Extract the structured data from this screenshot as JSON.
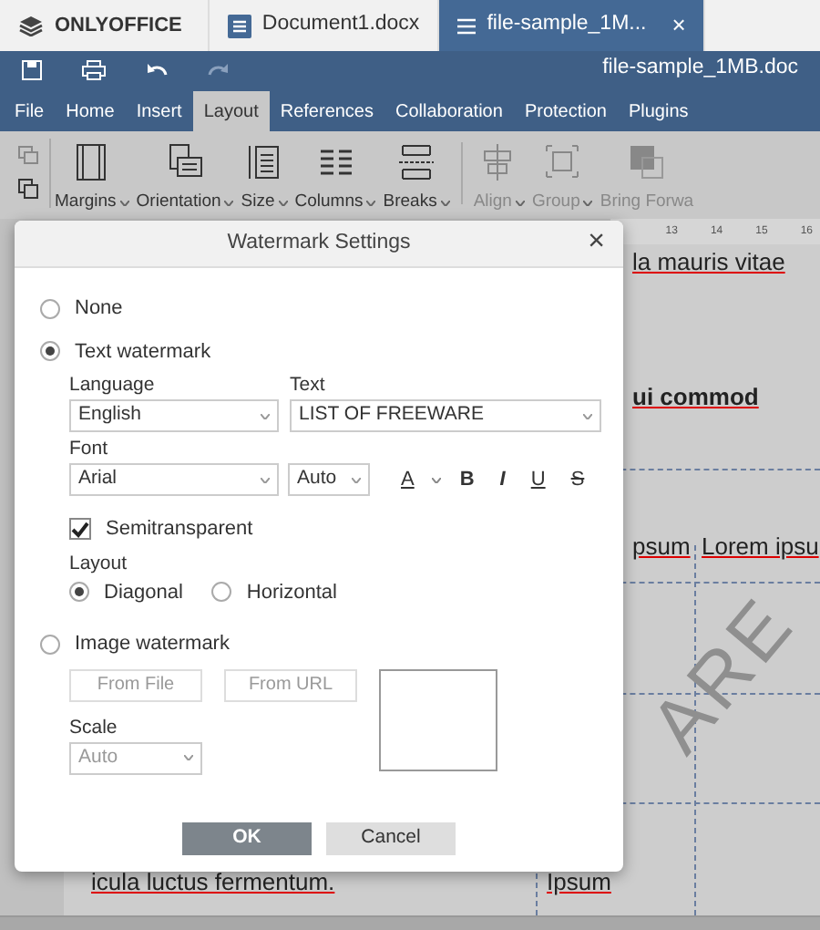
{
  "app_tabs": [
    {
      "label": "ONLYOFFICE",
      "kind": "logo",
      "selected": false
    },
    {
      "label": "Document1.docx",
      "kind": "doc",
      "selected": false
    },
    {
      "label": "file-sample_1M...",
      "kind": "doc",
      "selected": true,
      "close": "×"
    }
  ],
  "document_title": "file-sample_1MB.doc",
  "menu_tabs": [
    {
      "label": "File",
      "selected": false
    },
    {
      "label": "Home",
      "selected": false
    },
    {
      "label": "Insert",
      "selected": false
    },
    {
      "label": "Layout",
      "selected": true
    },
    {
      "label": "References",
      "selected": false
    },
    {
      "label": "Collaboration",
      "selected": false
    },
    {
      "label": "Protection",
      "selected": false
    },
    {
      "label": "Plugins",
      "selected": false
    }
  ],
  "ribbon": [
    {
      "label": "Margins",
      "kind": "margins",
      "disabled": false
    },
    {
      "label": "Orientation",
      "kind": "orientation",
      "disabled": false
    },
    {
      "label": "Size",
      "kind": "size",
      "disabled": false
    },
    {
      "label": "Columns",
      "kind": "columns",
      "disabled": false
    },
    {
      "label": "Breaks",
      "kind": "breaks",
      "disabled": false
    },
    {
      "label": "Align",
      "kind": "align",
      "disabled": true
    },
    {
      "label": "Group",
      "kind": "group",
      "disabled": true
    },
    {
      "label": "Bring Forwa",
      "kind": "bring",
      "disabled": true
    }
  ],
  "document": {
    "ruler": [
      "13",
      "14",
      "15",
      "16"
    ],
    "top_text": "la mauris vitae",
    "heading": "ui commod",
    "table_cells": [
      "psum",
      "Lorem ipsu"
    ],
    "bottom_text": "icula luctus fermentum.",
    "bottom_cell": "Ipsum",
    "watermark": "ARE"
  },
  "dialog": {
    "title": "Watermark Settings",
    "close": "×",
    "modes": [
      {
        "label": "None",
        "selected": false
      },
      {
        "label": "Text watermark",
        "selected": true
      },
      {
        "label": "Image watermark",
        "selected": false
      }
    ],
    "text_settings": {
      "language_label": "Language",
      "language": "English",
      "text_label": "Text",
      "text": "LIST OF FREEWARE",
      "font_label": "Font",
      "font": "Arial",
      "size": "Auto",
      "format_buttons": [
        {
          "label": "A",
          "kind": "color"
        },
        {
          "label": "B",
          "kind": "bold"
        },
        {
          "label": "I",
          "kind": "italic"
        },
        {
          "label": "U",
          "kind": "underline"
        },
        {
          "label": "S",
          "kind": "strike"
        }
      ],
      "semitransparent": {
        "label": "Semitransparent",
        "checked": true
      },
      "layout_label": "Layout",
      "layouts": [
        {
          "label": "Diagonal",
          "selected": true
        },
        {
          "label": "Horizontal",
          "selected": false
        }
      ]
    },
    "image_settings": {
      "disabled": true,
      "buttons": [
        "From File",
        "From URL"
      ],
      "scale_label": "Scale",
      "scale": "Auto"
    },
    "buttons": [
      {
        "label": "OK",
        "kind": "primary"
      },
      {
        "label": "Cancel",
        "kind": "secondary"
      }
    ]
  }
}
